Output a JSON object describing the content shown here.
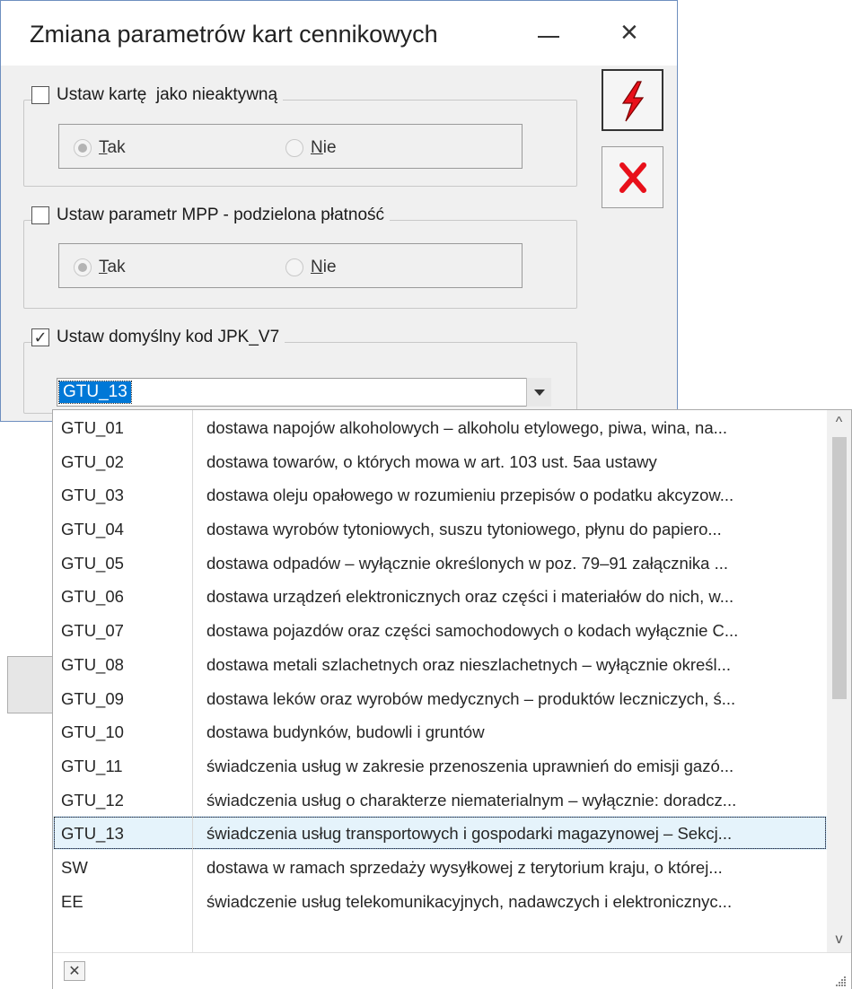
{
  "window": {
    "title": "Zmiana parametrów kart cennikowych",
    "minimize_icon": "minimize-icon",
    "close_icon": "close-icon"
  },
  "groups": [
    {
      "label": "Ustaw kartę  jako nieaktywną",
      "checked": false,
      "options": [
        {
          "label": "Tak",
          "mnemonic": "T",
          "rest": "ak",
          "selected": true
        },
        {
          "label": "Nie",
          "mnemonic": "N",
          "rest": "ie",
          "selected": false
        }
      ]
    },
    {
      "label": "Ustaw parametr MPP - podzielona płatność",
      "checked": false,
      "options": [
        {
          "label": "Tak",
          "mnemonic": "T",
          "rest": "ak",
          "selected": true
        },
        {
          "label": "Nie",
          "mnemonic": "N",
          "rest": "ie",
          "selected": false
        }
      ]
    },
    {
      "label": "Ustaw domyślny kod JPK_V7",
      "checked": true,
      "checkmark": "✓"
    }
  ],
  "combo": {
    "value": "GTU_13"
  },
  "side_buttons": {
    "confirm_icon": "lightning-icon",
    "cancel_icon": "red-x-icon"
  },
  "dropdown": {
    "rows": [
      {
        "code": "GTU_01",
        "desc": "dostawa napojów alkoholowych – alkoholu etylowego, piwa, wina, na..."
      },
      {
        "code": "GTU_02",
        "desc": "dostawa towarów, o których mowa w art. 103 ust. 5aa ustawy"
      },
      {
        "code": "GTU_03",
        "desc": "dostawa oleju opałowego w rozumieniu przepisów o podatku akcyzow..."
      },
      {
        "code": "GTU_04",
        "desc": "dostawa wyrobów tytoniowych, suszu tytoniowego, płynu do papiero..."
      },
      {
        "code": "GTU_05",
        "desc": "dostawa odpadów – wyłącznie określonych w poz. 79–91 załącznika ..."
      },
      {
        "code": "GTU_06",
        "desc": "dostawa urządzeń elektronicznych oraz części i materiałów do nich, w..."
      },
      {
        "code": "GTU_07",
        "desc": "dostawa pojazdów oraz części samochodowych o kodach wyłącznie C..."
      },
      {
        "code": "GTU_08",
        "desc": "dostawa metali szlachetnych oraz nieszlachetnych – wyłącznie określ..."
      },
      {
        "code": "GTU_09",
        "desc": "dostawa leków oraz wyrobów medycznych – produktów leczniczych, ś..."
      },
      {
        "code": "GTU_10",
        "desc": "dostawa budynków, budowli i gruntów"
      },
      {
        "code": "GTU_11",
        "desc": "świadczenia usług w zakresie przenoszenia uprawnień do emisji gazó..."
      },
      {
        "code": "GTU_12",
        "desc": "świadczenia usług o charakterze niematerialnym – wyłącznie: doradcz..."
      },
      {
        "code": "GTU_13",
        "desc": "świadczenia usług transportowych i gospodarki magazynowej – Sekcj...",
        "selected": true
      },
      {
        "code": "SW",
        "desc": "dostawa w ramach sprzedaży wysyłkowej z terytorium kraju, o której..."
      },
      {
        "code": "EE",
        "desc": "świadczenie usług telekomunikacyjnych, nadawczych i elektronicznyc..."
      }
    ],
    "scroll_up": "^",
    "scroll_down": "v",
    "close_glyph": "✕"
  },
  "colors": {
    "accent": "#0078d7",
    "selection": "#e5f3fb",
    "window_border": "#6e8fbf",
    "cancel_red": "#e8101a"
  }
}
